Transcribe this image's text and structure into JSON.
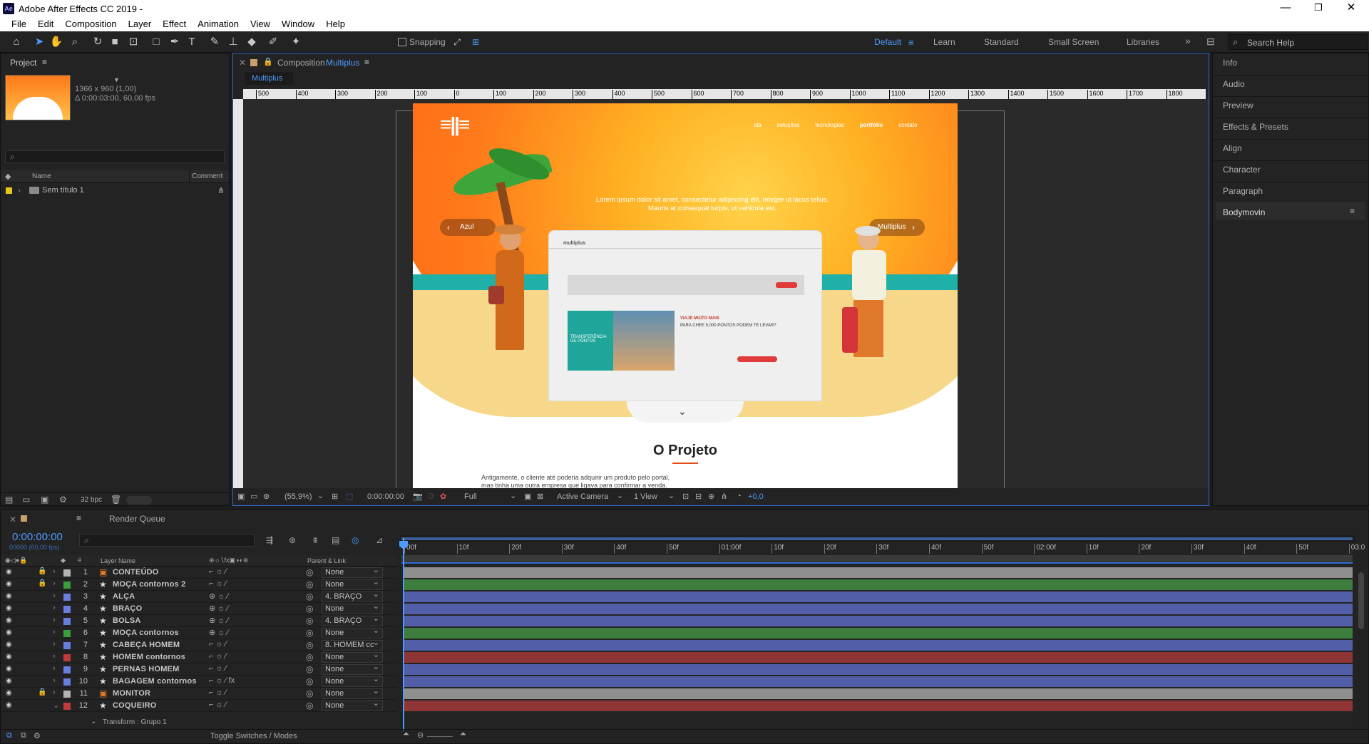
{
  "window": {
    "title": "Adobe After Effects CC 2019 -",
    "logo": "Ae",
    "minimize": "—",
    "restore": "❐",
    "close": "✕"
  },
  "menu": [
    "File",
    "Edit",
    "Composition",
    "Layer",
    "Effect",
    "Animation",
    "View",
    "Window",
    "Help"
  ],
  "toolbar": {
    "snapping": "Snapping",
    "workspaces": [
      "Default",
      "Learn",
      "Standard",
      "Small Screen",
      "Libraries"
    ],
    "search_placeholder": "Search Help"
  },
  "project": {
    "tab": "Project",
    "info_dims": "1366 x 960 (1,00)",
    "info_dur": "Δ 0:00:03:00, 60,00 fps",
    "col_name": "Name",
    "col_comment": "Comment",
    "item": "Sem título 1",
    "bpc": "32 bpc"
  },
  "comp": {
    "tab_prefix": "Composition",
    "tab_name": "Multiplus",
    "subtab": "Multiplus",
    "ruler": [
      "500",
      "400",
      "300",
      "200",
      "100",
      "0",
      "100",
      "200",
      "300",
      "400",
      "500",
      "600",
      "700",
      "800",
      "900",
      "1000",
      "1100",
      "1200",
      "1300",
      "1400",
      "1500",
      "1600",
      "1700",
      "1800"
    ],
    "zoom": "(55,9%)",
    "time": "0:00:00:00",
    "resolution": "Full",
    "camera": "Active Camera",
    "view": "1 View",
    "exposure": "+0,0",
    "site": {
      "nav": [
        "olá",
        "soluções",
        "tecnologias",
        "portfólio",
        "contato"
      ],
      "hero": "Lorem ipsum dolor sit amet, consectetur adipiscing elit. Integer ut lacus tellus.",
      "hero2": "Mauris at consequat turpis, ut vehicula est.",
      "prev": "Azul",
      "next": "Multiplus",
      "screen_brand": "multiplus",
      "travel1": "VIAJE MUITO MAIS",
      "travel2": "PARA CHEE 5.000 PONTOS PODEM TE LEVAR?",
      "transfer": "TRANSFERÊNCIA DE PONTOS",
      "section": "O Projeto",
      "body1": "Antigamente, o cliente até poderia adquirir um produto pelo portal,",
      "body2": "mas tinha uma outra empresa que ligava para confirmar a venda."
    }
  },
  "right": {
    "items": [
      "Info",
      "Audio",
      "Preview",
      "Effects & Presets",
      "Align",
      "Character",
      "Paragraph",
      "Bodymovin"
    ]
  },
  "timeline": {
    "tab": "Multiplus",
    "render": "Render Queue",
    "timecode": "0:00:00:00",
    "fps": "00000 (60,00 fps)",
    "col_layer": "Layer Name",
    "col_parent": "Parent & Link",
    "toggle": "Toggle Switches / Modes",
    "ticks": [
      "00f",
      "10f",
      "20f",
      "30f",
      "40f",
      "50f",
      "01:00f",
      "10f",
      "20f",
      "30f",
      "40f",
      "50f",
      "02:00f",
      "10f",
      "20f",
      "30f",
      "40f",
      "50f",
      "03:0"
    ],
    "layers": [
      {
        "n": "1",
        "name": "CONTEÚDO",
        "type": "comp",
        "color": "#b3b3b3",
        "parent": "None",
        "bar": "#8f8f8f",
        "lock": true
      },
      {
        "n": "2",
        "name": "MOÇA contornos 2",
        "type": "shape",
        "color": "#3a9e3a",
        "parent": "None",
        "bar": "#3d7d3d",
        "lock": true
      },
      {
        "n": "3",
        "name": "ALÇA",
        "type": "shape",
        "color": "#6a7de0",
        "parent": "4. BRAÇO",
        "bar": "#525fa8",
        "lock": false
      },
      {
        "n": "4",
        "name": "BRAÇO",
        "type": "shape",
        "color": "#6a7de0",
        "parent": "None",
        "bar": "#525fa8",
        "lock": false
      },
      {
        "n": "5",
        "name": "BOLSA",
        "type": "shape",
        "color": "#6a7de0",
        "parent": "4. BRAÇO",
        "bar": "#525fa8",
        "lock": false
      },
      {
        "n": "6",
        "name": "MOÇA contornos",
        "type": "shape",
        "color": "#3a9e3a",
        "parent": "None",
        "bar": "#3d7d3d",
        "lock": false
      },
      {
        "n": "7",
        "name": "CABEÇA HOMEM",
        "type": "shape",
        "color": "#6a7de0",
        "parent": "8. HOMEM cc",
        "bar": "#525fa8",
        "lock": false
      },
      {
        "n": "8",
        "name": "HOMEM contornos",
        "type": "shape",
        "color": "#c03a3a",
        "parent": "None",
        "bar": "#8f3535",
        "lock": false
      },
      {
        "n": "9",
        "name": "PERNAS HOMEM",
        "type": "shape",
        "color": "#6a7de0",
        "parent": "None",
        "bar": "#525fa8",
        "lock": false
      },
      {
        "n": "10",
        "name": "BAGAGEM contornos",
        "type": "shape",
        "color": "#6a7de0",
        "parent": "None",
        "bar": "#525fa8",
        "lock": false
      },
      {
        "n": "11",
        "name": "MONITOR",
        "type": "comp",
        "color": "#b3b3b3",
        "parent": "None",
        "bar": "#8f8f8f",
        "lock": true
      },
      {
        "n": "12",
        "name": "COQUEIRO",
        "type": "shape",
        "color": "#c03a3a",
        "parent": "None",
        "bar": "#8f3535",
        "lock": false
      }
    ],
    "subprop": "Transform : Grupo 1"
  }
}
